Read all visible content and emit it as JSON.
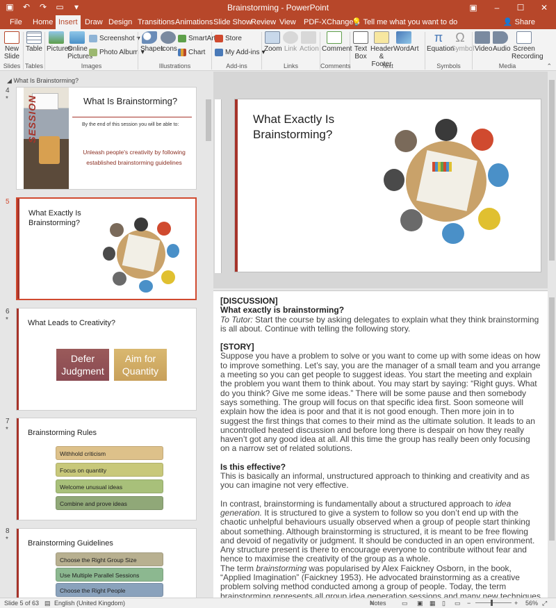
{
  "window": {
    "title": "Brainstorming  -  PowerPoint",
    "min": "–",
    "max": "☐",
    "close": "✕"
  },
  "tabs": [
    {
      "label": "File"
    },
    {
      "label": "Home"
    },
    {
      "label": "Insert"
    },
    {
      "label": "Draw"
    },
    {
      "label": "Design"
    },
    {
      "label": "Transitions"
    },
    {
      "label": "Animations"
    },
    {
      "label": "Slide Show"
    },
    {
      "label": "Review"
    },
    {
      "label": "View"
    },
    {
      "label": "PDF-XChange 4"
    }
  ],
  "tell_me": "Tell me what you want to do",
  "share": "Share",
  "ribbon": {
    "new_slide": "New Slide",
    "table": "Table",
    "pictures": "Pictures",
    "online_pictures": "Online Pictures",
    "screenshot": "Screenshot",
    "photo_album": "Photo Album",
    "shapes": "Shapes",
    "icons": "Icons",
    "smartart": "SmartArt",
    "chart": "Chart",
    "store": "Store",
    "my_addins": "My Add-ins",
    "zoom": "Zoom",
    "link": "Link",
    "action": "Action",
    "comment": "Comment",
    "text_box": "Text Box",
    "header_footer": "Header & Footer",
    "wordart": "WordArt",
    "equation": "Equation",
    "symbol": "Symbol",
    "video": "Video",
    "audio": "Audio",
    "screen_recording": "Screen Recording",
    "groups": {
      "slides": "Slides",
      "tables": "Tables",
      "images": "Images",
      "illustrations": "Illustrations",
      "addins": "Add-ins",
      "links": "Links",
      "comments": "Comments",
      "text": "Text",
      "symbols": "Symbols",
      "media": "Media"
    }
  },
  "section": "What Is Brainstorming?",
  "thumbnails": {
    "s4": {
      "num": "4",
      "title": "What Is Brainstorming?",
      "session": "SESSION",
      "intro": "By the end of this session you will be able to:",
      "objective": "Unleash people's creativity by following established brainstorming guidelines"
    },
    "s5": {
      "num": "5",
      "title": "What Exactly Is Brainstorming?"
    },
    "s6": {
      "num": "6",
      "title": "What Leads to Creativity?",
      "box1": "Defer Judgment",
      "box2": "Aim for Quantity"
    },
    "s7": {
      "num": "7",
      "title": "Brainstorming Rules",
      "items": [
        "Withhold criticism",
        "Focus on quantity",
        "Welcome unusual ideas",
        "Combine and prove ideas"
      ]
    },
    "s8": {
      "num": "8",
      "title": "Brainstorming Guidelines",
      "items": [
        "Choose the Right Group Size",
        "Use Multiple Parallel Sessions",
        "Choose the Right People"
      ]
    }
  },
  "slide": {
    "title": "What Exactly Is Brainstorming?"
  },
  "notes": {
    "h1": "[DISCUSSION]",
    "h2": "What exactly is brainstorming?",
    "tutor_label": "To Tutor:",
    "tutor_text": " Start the course by asking delegates to explain what they think brainstorming is all about. Continue with telling the following story.",
    "h3": "[STORY]",
    "story": "Suppose you have a problem to solve or you want to come up with some ideas on how to improve something. Let’s say, you are the manager of a small team and you arrange a meeting so you can get people to suggest ideas. You start the meeting and explain the problem you want them to think about. You may start by saying:  “Right guys. What do you think? Give me some ideas.” There will be some pause and then somebody says something. The group will focus on that specific idea first. Soon someone will explain how the idea is poor and that it is not good enough. Then more join in to suggest the first things that comes to their mind as the ultimate solution. It leads to an uncontrolled heated discussion and before long there is despair on how they really haven’t got any good idea at all. All this time the group has really been only focusing on a narrow set of related solutions.",
    "h4": "Is this effective?",
    "effective": "This is basically an informal, unstructured approach to thinking and creativity and as you can imagine not very effective.",
    "contrast_a": "In contrast, brainstorming is fundamentally about a structured approach to ",
    "contrast_em": "idea generation.",
    "contrast_b": " It is structured  to give a system to follow so you don’t end up with the chaotic unhelpful behaviours usually observed when a group of people start thinking about something. Although brainstorming is structured, it is meant to be free flowing and devoid of negativity or judgment. It should be conducted in an open environment. Any structure present is there to encourage everyone to contribute without fear and hence to maximise the creativity of the group as a whole.",
    "term_a": "The term ",
    "term_em": "brainstorming",
    "term_b": " was popularised by Alex Faickney Osborn, in the book, “Applied Imagination” (Faickney 1953). He advocated brainstorming as a creative problem solving method conducted among a group of people. Today, the term brainstorming represents all group idea generation sessions and many new techniques have been introduced since then."
  },
  "status": {
    "slide": "Slide 5 of 63",
    "language": "English (United Kingdom)",
    "notes": "Notes",
    "zoom": "56%"
  }
}
